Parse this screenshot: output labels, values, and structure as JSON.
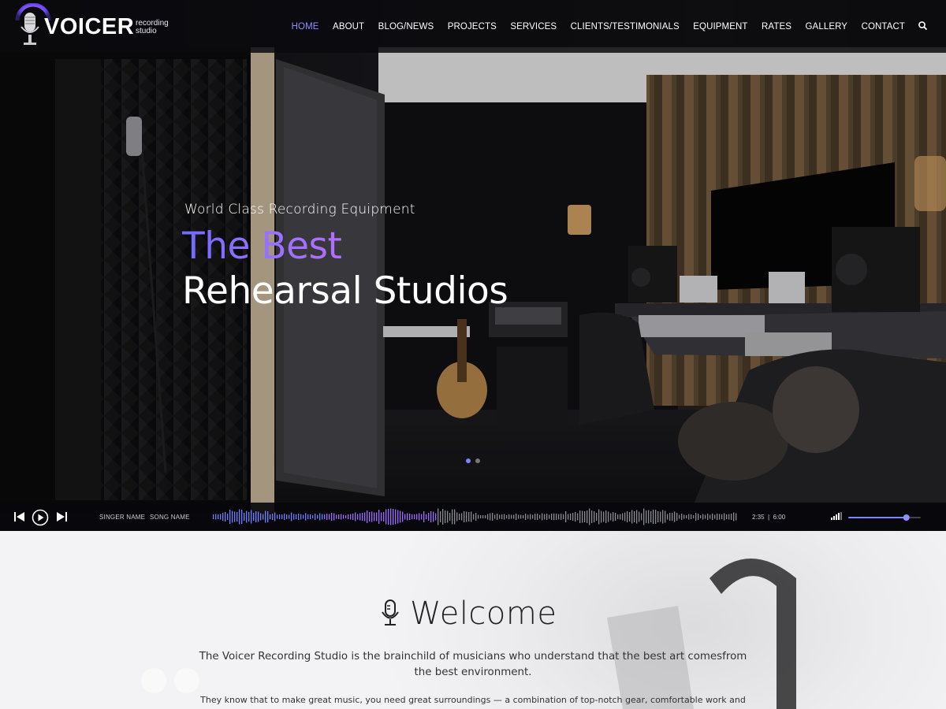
{
  "brand": {
    "name": "VOICER",
    "tagline": "recording studio"
  },
  "nav": {
    "items": [
      {
        "label": "HOME",
        "active": true
      },
      {
        "label": "ABOUT"
      },
      {
        "label": "BLOG/NEWS"
      },
      {
        "label": "PROJECTS"
      },
      {
        "label": "SERVICES"
      },
      {
        "label": "CLIENTS/TESTIMONIALS"
      },
      {
        "label": "EQUIPMENT"
      },
      {
        "label": "RATES"
      },
      {
        "label": "GALLERY"
      },
      {
        "label": "CONTACT"
      }
    ],
    "search_icon": "search-icon"
  },
  "hero": {
    "kicker": "World Class Recording Equipment",
    "headline_line1": "The Best",
    "headline_line2": "Rehearsal Studios",
    "slides": 2,
    "active_slide": 1
  },
  "player": {
    "singer": "SINGER NAME",
    "song": "SONG NAME",
    "time_current": "2:35",
    "time_total": "6:00",
    "progress": 0.43,
    "volume": 0.78,
    "icons": [
      "prev-icon",
      "play-icon",
      "next-icon",
      "volume-icon"
    ]
  },
  "welcome": {
    "title": "Welcome",
    "lead": "The Voicer Recording Studio is the brainchild of musicians who understand that the best  art comesfrom the best environment.",
    "body": "They know that to make great music, you need great surroundings — a combination of top-notch gear, comfortable work and"
  },
  "colors": {
    "accent": "#7a6dff",
    "accent_2": "#b46dff",
    "header_bg": "#0a0a0e",
    "welcome_bg": "#f0f0f2"
  }
}
